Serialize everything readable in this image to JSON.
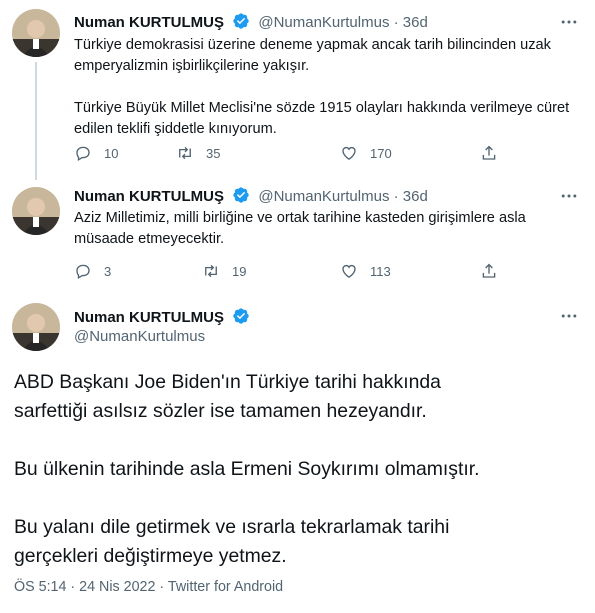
{
  "author": {
    "name": "Numan KURTULMUŞ",
    "handle": "@NumanKurtulmus"
  },
  "tweets": [
    {
      "time": "36d",
      "separator": "·",
      "lines": [
        "Türkiye demokrasisi üzerine deneme yapmak ancak tarih bilincinden uzak",
        "emperyalizmin işbirlikçilerine yakışır.",
        "Türkiye Büyük Millet Meclisi'ne sözde 1915 olayları hakkında verilmeye cüret",
        "edilen teklifi şiddetle kınıyorum."
      ],
      "replies": "10",
      "retweets": "35",
      "likes": "170"
    },
    {
      "time": "36d",
      "separator": "·",
      "lines": [
        "Aziz Milletimiz, milli birliğine ve ortak tarihine kasteden girişimlere asla",
        "müsaade etmeyecektir."
      ],
      "replies": "3",
      "retweets": "19",
      "likes": "113"
    }
  ],
  "main_tweet": {
    "paragraphs": [
      "ABD Başkanı Joe Biden'ın Türkiye tarihi hakkında",
      "sarfettiği asılsız sözler ise tamamen hezeyandır.",
      "Bu ülkenin tarihinde asla Ermeni Soykırımı olmamıştır.",
      "Bu yalanı dile getirmek ve ısrarla tekrarlamak tarihi",
      "gerçekleri değiştirmeye yetmez."
    ],
    "meta": "ÖS 5:14 · 24 Nis 2022 · Twitter for Android"
  },
  "colors": {
    "verified": "#1d9bf0",
    "secondary_text": "#536471",
    "thread_line": "#cfd9de"
  },
  "icons": {
    "verified": "verified-badge-icon",
    "more": "more-icon",
    "reply": "reply-icon",
    "retweet": "retweet-icon",
    "like": "heart-icon",
    "share": "share-icon"
  }
}
